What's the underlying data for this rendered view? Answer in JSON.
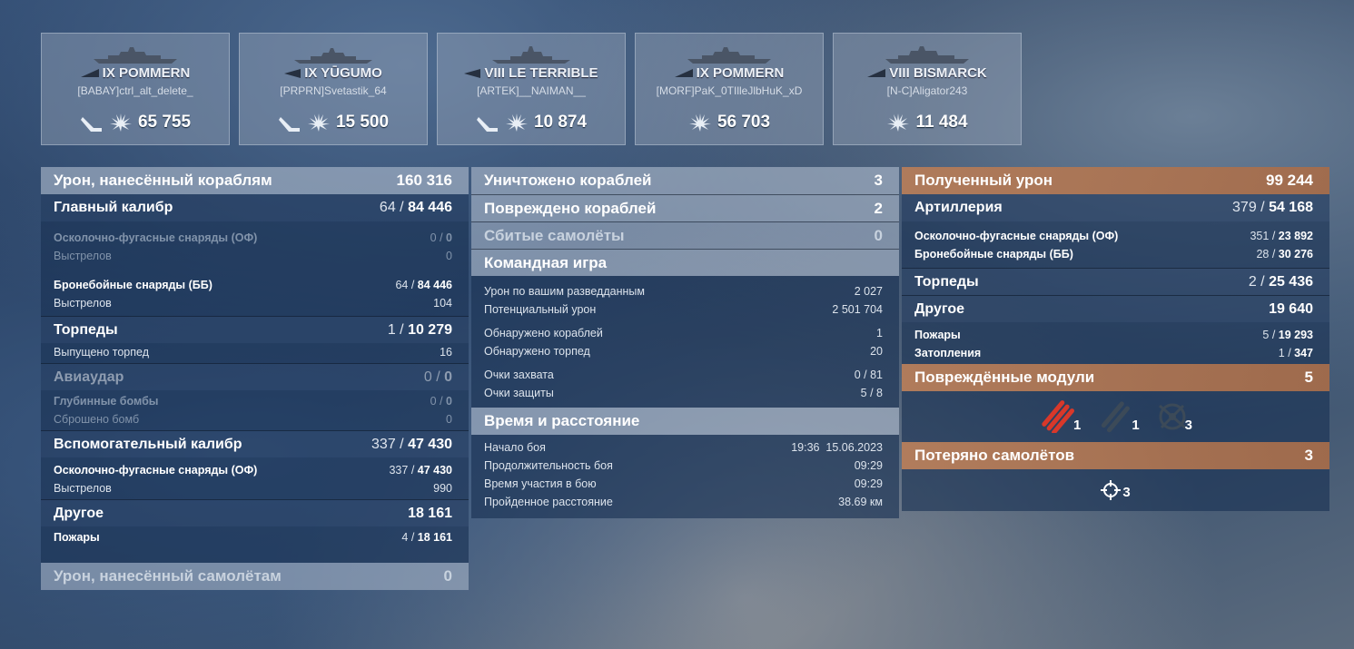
{
  "ships": [
    {
      "tier_name": "IX POMMERN",
      "player": "[BABAY]ctrl_alt_delete_",
      "damage": "65 755",
      "icons": [
        "sunk-icon",
        "damage-icon"
      ]
    },
    {
      "tier_name": "IX YŪGUMO",
      "player": "[PRPRN]Svetastik_64",
      "damage": "15 500",
      "icons": [
        "sunk-icon",
        "damage-icon"
      ]
    },
    {
      "tier_name": "VIII LE TERRIBLE",
      "player": "[ARTEK]__NAIMAN__",
      "damage": "10 874",
      "icons": [
        "sunk-icon",
        "damage-icon"
      ]
    },
    {
      "tier_name": "IX POMMERN",
      "player": "[MORF]PaK_0TIlleJlbHuK_xD",
      "damage": "56 703",
      "icons": [
        "damage-icon"
      ]
    },
    {
      "tier_name": "VIII BISMARCK",
      "player": "[N-C]Aligator243",
      "damage": "11 484",
      "icons": [
        "damage-icon"
      ]
    }
  ],
  "left": {
    "damage_ships_label": "Урон, нанесённый кораблям",
    "damage_ships_value": "160 316",
    "main_label": "Главный калибр",
    "main_hits": "64",
    "main_value": "84 446",
    "he_label": "Осколочно-фугасные снаряды (ОФ)",
    "he_hits": "0",
    "he_value": "0",
    "he_shots_label": "Выстрелов",
    "he_shots": "0",
    "ap_label": "Бронебойные снаряды (ББ)",
    "ap_hits": "64",
    "ap_value": "84 446",
    "ap_shots_label": "Выстрелов",
    "ap_shots": "104",
    "torp_label": "Торпеды",
    "torp_hits": "1",
    "torp_value": "10 279",
    "torp_launched_label": "Выпущено торпед",
    "torp_launched": "16",
    "air_label": "Авиаудар",
    "air_hits": "0",
    "air_value": "0",
    "depth_label": "Глубинные бомбы",
    "depth_hits": "0",
    "depth_value": "0",
    "bombs_label": "Сброшено бомб",
    "bombs": "0",
    "sec_label": "Вспомогательный калибр",
    "sec_hits": "337",
    "sec_value": "47 430",
    "sec_he_label": "Осколочно-фугасные снаряды (ОФ)",
    "sec_he_hits": "337",
    "sec_he_value": "47 430",
    "sec_shots_label": "Выстрелов",
    "sec_shots": "990",
    "other_label": "Другое",
    "other_value": "18 161",
    "fires_label": "Пожары",
    "fires_hits": "4",
    "fires_value": "18 161",
    "planes_label": "Урон, нанесённый самолётам",
    "planes_value": "0"
  },
  "middle": {
    "destroyed_label": "Уничтожено кораблей",
    "destroyed": "3",
    "damaged_label": "Повреждено кораблей",
    "damaged": "2",
    "shot_planes_label": "Сбитые самолёты",
    "shot_planes": "0",
    "team_label": "Командная игра",
    "spot_dmg_label": "Урон по вашим разведданным",
    "spot_dmg": "2 027",
    "potential_label": "Потенциальный урон",
    "potential": "2 501 704",
    "ships_spotted_label": "Обнаружено кораблей",
    "ships_spotted": "1",
    "torps_spotted_label": "Обнаружено торпед",
    "torps_spotted": "20",
    "capture_label": "Очки захвата",
    "capture": "0 / 81",
    "defense_label": "Очки защиты",
    "defense": "5 / 8",
    "time_label": "Время и расстояние",
    "start_label": "Начало боя",
    "start": "19:36  15.06.2023",
    "duration_label": "Продолжительность боя",
    "duration": "09:29",
    "time_in_battle_label": "Время участия в бою",
    "time_in_battle": "09:29",
    "distance_label": "Пройденное расстояние",
    "distance": "38.69 км"
  },
  "right": {
    "received_label": "Полученный урон",
    "received": "99 244",
    "art_label": "Артиллерия",
    "art_hits": "379",
    "art_value": "54 168",
    "he_label": "Осколочно-фугасные снаряды (ОФ)",
    "he_hits": "351",
    "he_value": "23 892",
    "ap_label": "Бронебойные снаряды (ББ)",
    "ap_hits": "28",
    "ap_value": "30 276",
    "torp_label": "Торпеды",
    "torp_hits": "2",
    "torp_value": "25 436",
    "other_label": "Другое",
    "other_value": "19 640",
    "fires_label": "Пожары",
    "fires_hits": "5",
    "fires_value": "19 293",
    "flood_label": "Затопления",
    "flood_hits": "1",
    "flood_value": "347",
    "modules_label": "Повреждённые модули",
    "modules": "5",
    "module_icons": [
      {
        "icon": "torpedo-tubes-icon",
        "count": "1",
        "color": "#d8382a"
      },
      {
        "icon": "gun-turret-icon",
        "count": "1",
        "color": "#3c4a58"
      },
      {
        "icon": "aa-gun-icon",
        "count": "3",
        "color": "#3c4a58"
      }
    ],
    "lost_planes_label": "Потеряно самолётов",
    "lost_planes": "3",
    "lost_planes_count": "3"
  }
}
